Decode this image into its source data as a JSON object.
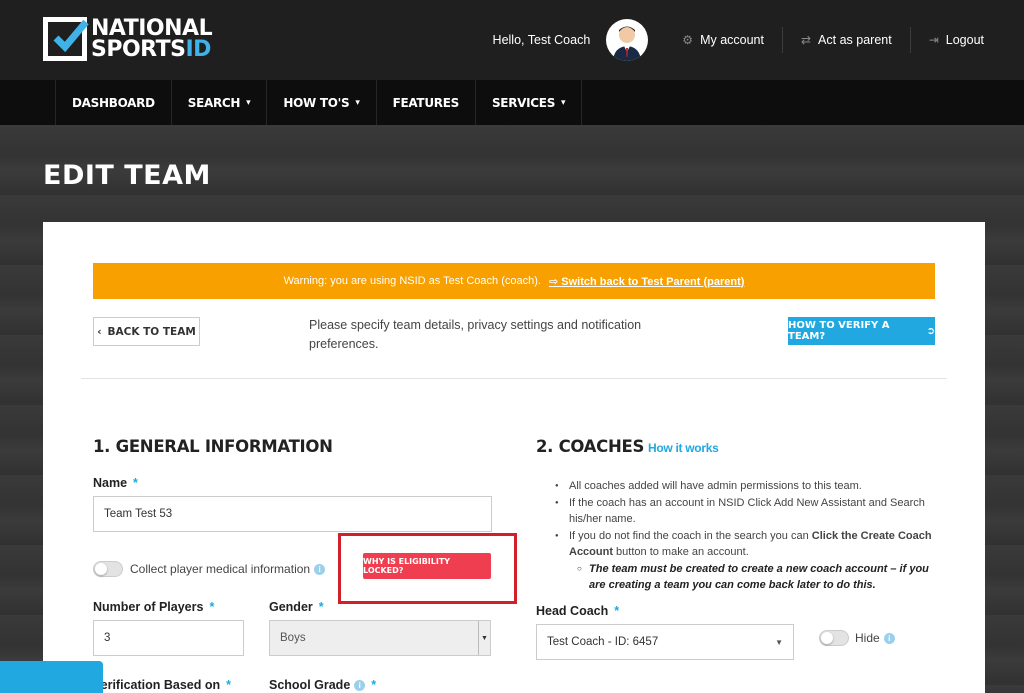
{
  "header": {
    "logo": {
      "line1": "NATIONAL",
      "line2_main": "SPORTS",
      "line2_accent": "ID"
    },
    "greeting": "Hello, Test Coach",
    "links": [
      {
        "label": "My account",
        "icon": "gear-icon"
      },
      {
        "label": "Act as parent",
        "icon": "swap-icon"
      },
      {
        "label": "Logout",
        "icon": "logout-icon"
      }
    ]
  },
  "nav": {
    "items": [
      {
        "label": "DASHBOARD"
      },
      {
        "label": "SEARCH"
      },
      {
        "label": "HOW TO'S"
      },
      {
        "label": "FEATURES"
      },
      {
        "label": "SERVICES"
      }
    ]
  },
  "page": {
    "title": "EDIT TEAM"
  },
  "warning": {
    "text": "Warning: you are using NSID as Test Coach (coach).",
    "switch_label": "Switch back to Test Parent (parent)"
  },
  "actions": {
    "back_label": "BACK TO TEAM",
    "intro": "Please specify team details, privacy settings and notification preferences.",
    "verify_label": "HOW TO VERIFY A TEAM?"
  },
  "general": {
    "title": "1. GENERAL INFORMATION",
    "name_label": "Name",
    "name_value": "Team Test 53",
    "medical_label": "Collect player medical information",
    "eligibility_label": "WHY IS ELIGIBILITY LOCKED?",
    "players_label": "Number of Players",
    "players_value": "3",
    "gender_label": "Gender",
    "gender_value": "Boys",
    "verification_label": "Verification Based on",
    "grade_label": "School Grade"
  },
  "coaches": {
    "title": "2. COACHES",
    "how_link": "How it works",
    "bullets": [
      "All coaches added will have admin permissions to this team.",
      "If the coach has an account in NSID Click Add New Assistant and Search his/her name."
    ],
    "bullet3_pre": "If you do not find the coach in the search you can ",
    "bullet3_bold": "Click the Create Coach Account",
    "bullet3_post": " button to make an account.",
    "sub_note": "The team must be created to create a new coach account – if you are creating a team you can come back later to do this.",
    "head_coach_label": "Head Coach",
    "head_coach_value": "Test Coach - ID: 6457",
    "hide_label": "Hide"
  }
}
